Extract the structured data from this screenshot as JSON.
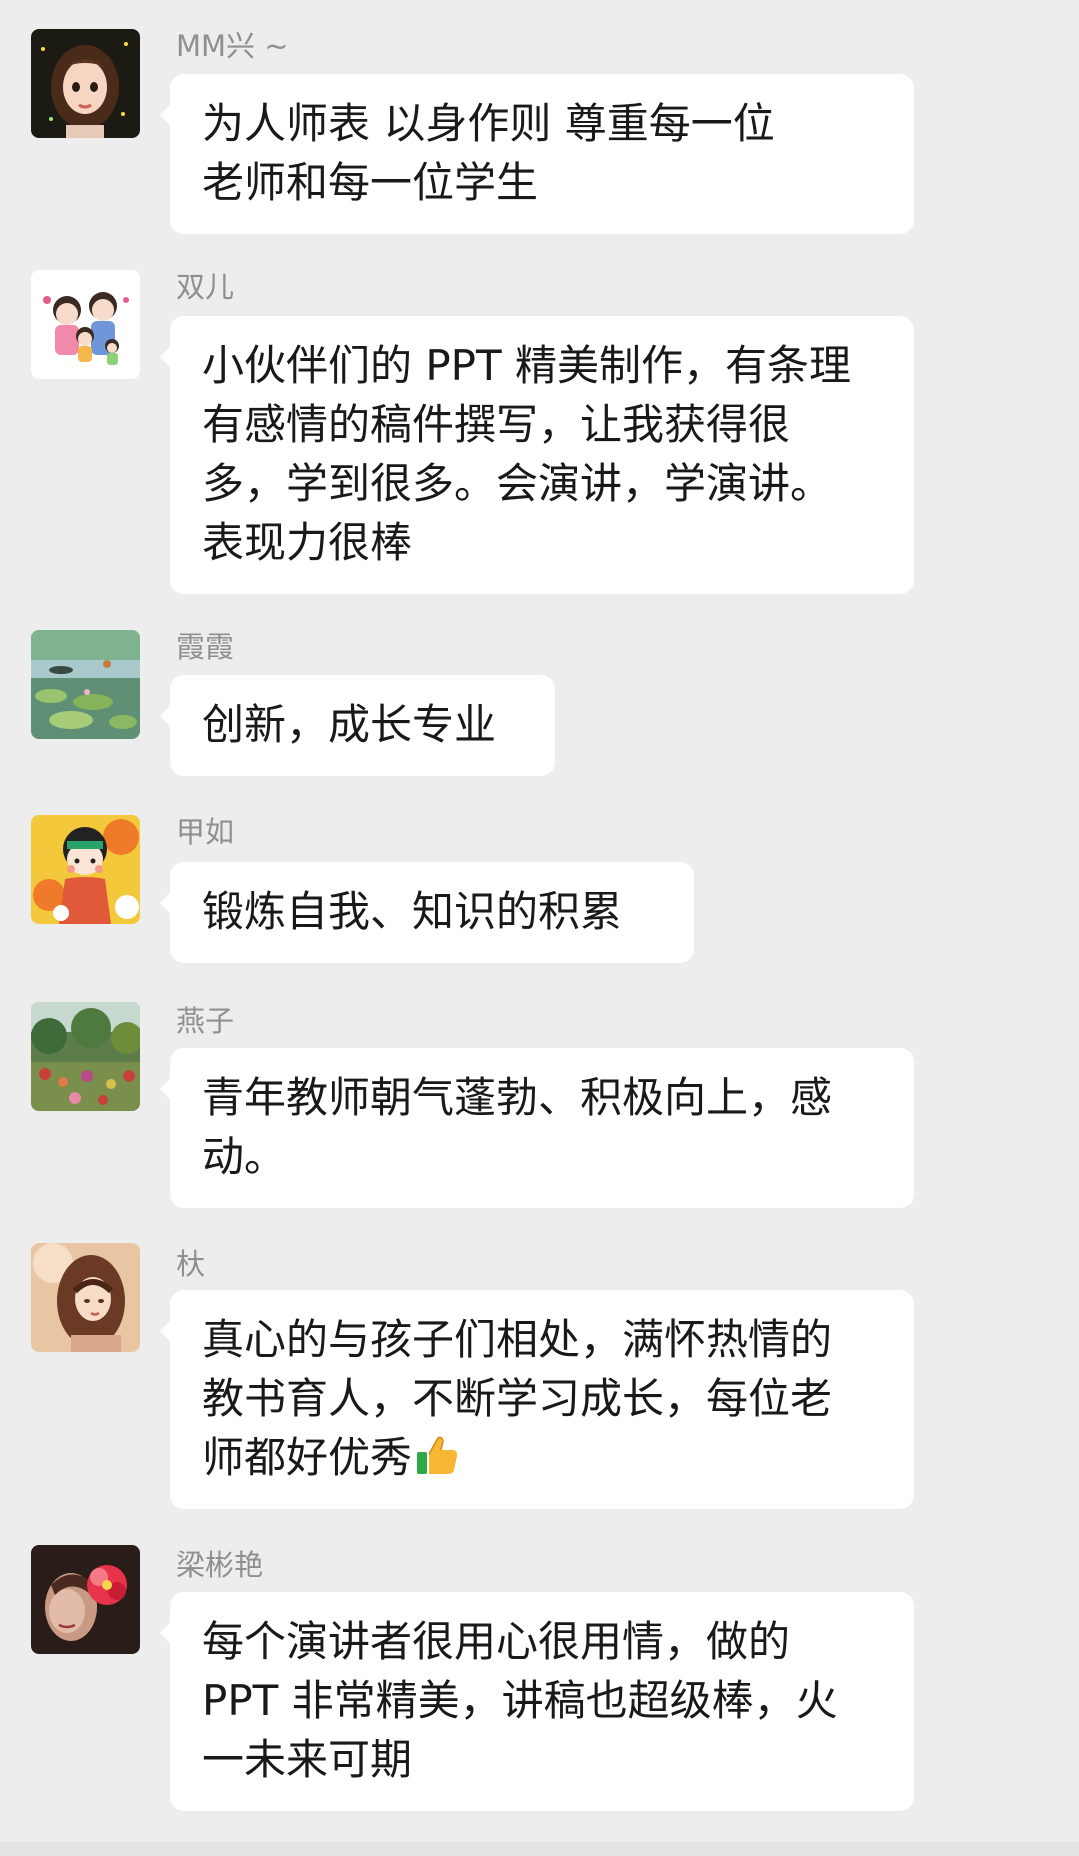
{
  "messages": [
    {
      "name": "MM兴 ~",
      "text": "为人师表   以身作则   尊重每一位\n老师和每一位学生",
      "avatar": "cartoon-girl-avatar"
    },
    {
      "name": "双儿",
      "text": "小伙伴们的 PPT 精美制作，有条理\n有感情的稿件撰写，让我获得很\n多，学到很多。会演讲，学演讲。\n表现力很棒",
      "avatar": "cartoon-family-avatar"
    },
    {
      "name": "霞霞",
      "text": "创新，成长专业",
      "avatar": "lotus-pond-avatar"
    },
    {
      "name": "甲如",
      "text": "锻炼自我、知识的积累",
      "avatar": "cartoon-child-flowers-avatar"
    },
    {
      "name": "燕子",
      "text": "青年教师朝气蓬勃、积极向上，感\n动。",
      "avatar": "garden-avatar"
    },
    {
      "name": "杕",
      "text": "真心的与孩子们相处，满怀热情的\n教书育人，不断学习成长，每位老\n师都好优秀",
      "avatar": "illustrated-girl-avatar",
      "emoji": "thumbs-up-icon"
    },
    {
      "name": "梁彬艳",
      "text": "每个演讲者很用心很用情，做的\nPPT 非常精美，讲稿也超级棒，火\n一未来可期",
      "avatar": "woman-flower-avatar"
    }
  ],
  "colors": {
    "background": "#ededed",
    "bubble": "#ffffff",
    "name": "#8f8f8f",
    "text": "#191919"
  }
}
